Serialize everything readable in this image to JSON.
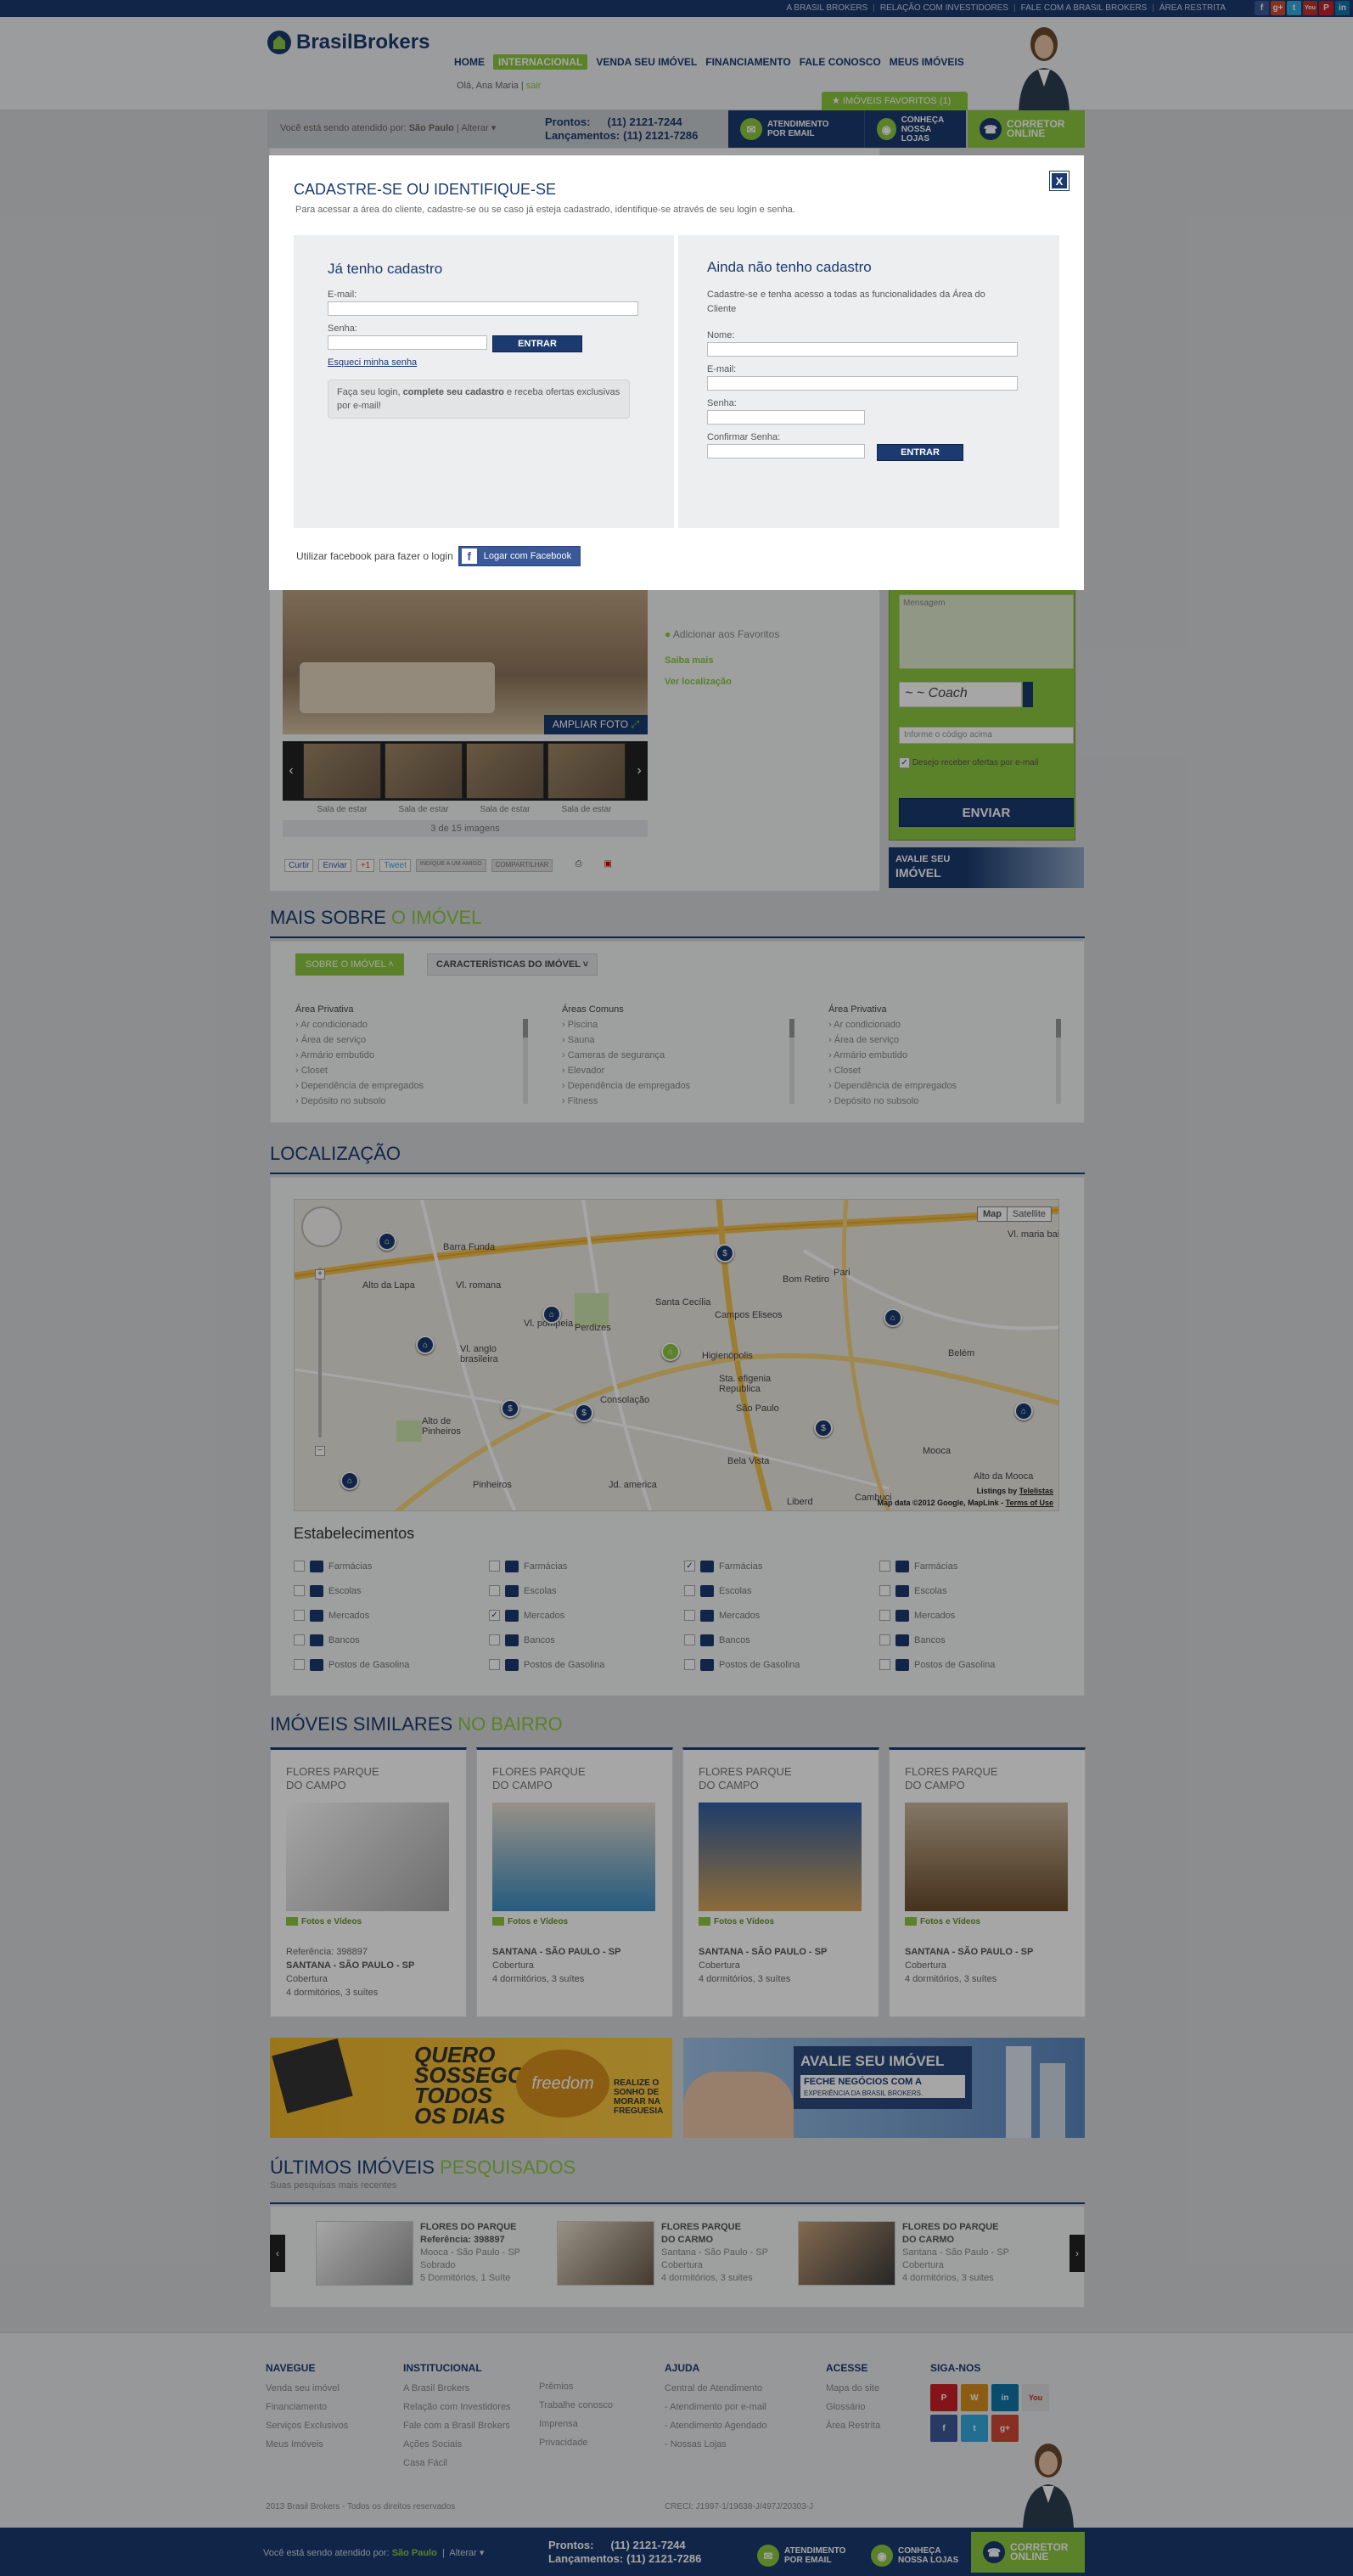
{
  "topbar": {
    "links": [
      "A BRASIL BROKERS",
      "RELAÇÃO COM INVESTIDORES",
      "FALE COM A BRASIL BROKERS",
      "ÁREA RESTRITA"
    ],
    "social": [
      "f",
      "g+",
      "t",
      "You",
      "P",
      "in"
    ]
  },
  "header": {
    "logo_b": "Brasil",
    "logo_rest": "Brokers",
    "nav": [
      "HOME",
      "INTERNACIONAL",
      "VENDA SEU IMÓVEL",
      "FINANCIAMENTO",
      "FALE CONOSCO",
      "MEUS IMÓVEIS"
    ],
    "greeting": "Olá, Ana Maria",
    "logout": "sair",
    "favorites": "IMÓVEIS FAVORITOS (1)"
  },
  "strip": {
    "attended_by": "Você está sendo atendido por:",
    "city": "São Paulo",
    "change": "Alterar",
    "prontos_label": "Prontos:",
    "prontos_phone": "(11) 2121-7244",
    "lanc_label": "Lançamentos:",
    "lanc_phone": "(11) 2121-7286",
    "email_l1": "ATENDIMENTO",
    "email_l2": "POR EMAIL",
    "lojas_l1": "CONHEÇA",
    "lojas_l2": "NOSSA LOJAS",
    "corretor_l1": "CORRETOR",
    "corretor_l2": "ONLINE"
  },
  "modal": {
    "title": "CADASTRE-SE OU IDENTIFIQUE-SE",
    "subtitle": "Para acessar a área do cliente, cadastre-se ou se caso já esteja cadastrado, identifique-se através de seu login e senha.",
    "close": "X",
    "left": {
      "title": "Já tenho cadastro",
      "email_label": "E-mail:",
      "password_label": "Senha:",
      "submit": "ENTRAR",
      "forgot": "Esqueci minha senha",
      "note_pre": "Faça seu login,",
      "note_bold": "complete seu cadastro",
      "note_post": "e receba ofertas exclusivas por e-mail!"
    },
    "right": {
      "title": "Ainda não tenho cadastro",
      "intro": "Cadastre-se e tenha acesso a todas as funcionalidades da Área do Cliente",
      "name_label": "Nome:",
      "email_label": "E-mail:",
      "password_label": "Senha:",
      "confirm_label": "Confirmar Senha:",
      "submit": "ENTRAR"
    },
    "facebook_text": "Utilizar facebook para fazer o login",
    "facebook_button": "Logar com Facebook"
  },
  "property": {
    "enlarge": "AMPLIAR FOTO",
    "thumbs": [
      "Sala de estar",
      "Sala de estar",
      "Sala de estar",
      "Sala de estar"
    ],
    "counter": "3 de 15 imagens",
    "share": [
      "Curtir",
      "Enviar",
      "+1",
      "Tweet",
      "INDIQUE A UM AMIGO",
      "COMPARTILHAR"
    ],
    "favorites": "Adicionar aos Favoritos",
    "more": "Saiba mais",
    "location": "Ver localização",
    "form_message": "Mensagem",
    "captcha_placeholder": "Informe o código acima",
    "newsletter": "Desejo receber ofertas por e-mail",
    "send": "ENVIAR",
    "avalie_l1": "AVALIE SEU",
    "avalie_l2": "IMÓVEL"
  },
  "more_about": {
    "title_a": "MAIS SOBRE",
    "title_b": "O IMÓVEL",
    "tab1": "SOBRE O IMÓVEL",
    "tab2": "CARACTERÍSTICAS DO IMÓVEL",
    "columns": [
      {
        "title": "Área Privativa",
        "items": [
          "Ar condicionado",
          "Área de serviço",
          "Armário embutido",
          "Closet",
          "Dependência de empregados",
          "Depósito no subsolo"
        ]
      },
      {
        "title": "Áreas Comuns",
        "items": [
          "Piscina",
          "Sauna",
          "Cameras de segurança",
          "Elevador",
          "Dependência de empregados",
          "Fitness"
        ]
      },
      {
        "title": "Área Privativa",
        "items": [
          "Ar condicionado",
          "Área de serviço",
          "Armário embutido",
          "Closet",
          "Dependência de empregados",
          "Depósito no subsolo"
        ]
      }
    ]
  },
  "location": {
    "title": "LOCALIZAÇÃO",
    "map_btn": "Map",
    "sat_btn": "Satellite",
    "copyright": "Map data ©2012 Google, MapLink -",
    "terms": "Terms of Use",
    "listings": "Listings by",
    "listings_src": "Telelistas",
    "places": [
      "Barra Funda",
      "Alto da Lapa",
      "Vl. romana",
      "Vl. pompeia",
      "Perdizes",
      "Santa Cecília",
      "Campos Eliseos",
      "Bom Retiro",
      "Pari",
      "Vl. maria baixa",
      "Vl. anglo brasileira",
      "Higienópolis",
      "Sta. efigenia Republica",
      "Belém",
      "Consolação",
      "São Paulo",
      "Alto de Pinheiros",
      "Bela Vista",
      "Mooca",
      "Alto da Mooca",
      "Pinheiros",
      "Jd. america",
      "Liberd",
      "Cambuci"
    ],
    "establishments_title": "Estabelecimentos",
    "categories": [
      "Farmácias",
      "Escolas",
      "Mercados",
      "Bancos",
      "Postos de Gasolina"
    ],
    "checked": [
      [
        false,
        false,
        false,
        false,
        false
      ],
      [
        false,
        false,
        true,
        false,
        false
      ],
      [
        true,
        false,
        false,
        false,
        false
      ],
      [
        false,
        false,
        false,
        false,
        false
      ]
    ]
  },
  "similar": {
    "title_a": "IMÓVEIS SIMILARES",
    "title_b": "NO BAIRRO",
    "cards": [
      {
        "t1": "FLORES PARQUE",
        "t2": "DO CAMPO",
        "media": "Fotos e Vídeos",
        "ref": "Referência: 398897",
        "loc": "SANTANA - SÃO PAULO - SP",
        "type": "Cobertura",
        "rooms": "4 dormitórios, 3 suítes"
      },
      {
        "t1": "FLORES PARQUE",
        "t2": "DO CAMPO",
        "media": "Fotos e Vídeos",
        "ref": "",
        "loc": "SANTANA - SÃO PAULO - SP",
        "type": "Cobertura",
        "rooms": "4 dormitórios, 3 suítes"
      },
      {
        "t1": "FLORES PARQUE",
        "t2": "DO CAMPO",
        "media": "Fotos e Vídeos",
        "ref": "",
        "loc": "SANTANA - SÃO PAULO - SP",
        "type": "Cobertura",
        "rooms": "4 dormitórios, 3 suítes"
      },
      {
        "t1": "FLORES PARQUE",
        "t2": "DO CAMPO",
        "media": "Fotos e Vídeos",
        "ref": "",
        "loc": "SANTANA - SÃO PAULO - SP",
        "type": "Cobertura",
        "rooms": "4 dormitórios, 3 suítes"
      }
    ]
  },
  "banners": {
    "freedom_a": "QUERO",
    "freedom_b": "SOSSEGO",
    "freedom_c": "TODOS",
    "freedom_d": "OS DIAS",
    "freedom_brand": "freedom",
    "freedom_side": "REALIZE O SONHO DE MORAR NA FREGUESIA",
    "avalie_title": "AVALIE SEU IMÓVEL",
    "avalie_l1": "FECHE NEGÓCIOS COM A",
    "avalie_l2": "EXPERIÊNCIA DA BRASIL BROKERS."
  },
  "recent": {
    "title_a": "ÚLTIMOS IMÓVEIS",
    "title_b": "PESQUISADOS",
    "subtitle": "Suas pesquisas mais recentes",
    "items": [
      {
        "t1": "FLORES DO PARQUE",
        "t2": "Referência: 398897",
        "loc": "Mooca - São Paulo - SP",
        "type": "Sobrado",
        "rooms": "5 Dormitórios, 1 Suíte"
      },
      {
        "t1": "FLORES PARQUE",
        "t2": "DO CARMO",
        "loc": "Santana - São Paulo - SP",
        "type": "Cobertura",
        "rooms": "4 dormitórios, 3 suites"
      },
      {
        "t1": "FLORES DO PARQUE",
        "t2": "DO CARMO",
        "loc": "Santana - São Paulo - SP",
        "type": "Cobertura",
        "rooms": "4 dormitórios, 3 suites"
      }
    ]
  },
  "footer": {
    "cols": [
      {
        "title": "NAVEGUE",
        "items": [
          "Venda seu imóvel",
          "Financiamento",
          "Serviços Exclusivos",
          "Meus Imóveis"
        ]
      },
      {
        "title": "INSTITUCIONAL",
        "items": [
          "A Brasil Brokers",
          "Relação com Investidores",
          "Fale com a Brasil Brokers",
          "Ações Sociais",
          "Casa Fácil"
        ]
      },
      {
        "title": "",
        "items": [
          "Prêmios",
          "Trabalhe conosco",
          "Imprensa",
          "Privacidade"
        ]
      },
      {
        "title": "AJUDA",
        "items": [
          "Central de Atendimento",
          "- Atendimento por e-mail",
          "- Atendimento Agendado",
          "- Nossas Lojas"
        ]
      },
      {
        "title": "ACESSE",
        "items": [
          "Mapa do site",
          "Glossário",
          "Área Restrita"
        ]
      },
      {
        "title": "SIGA-NOS",
        "items": []
      }
    ],
    "copyright": "2013 Brasil Brokers - Todos os direitos reservados",
    "creci": "CRECI: J1997-1/19638-J/497J/20303-J"
  },
  "colors": {
    "navy": "#1b3a6f",
    "green": "#8cc63f"
  }
}
